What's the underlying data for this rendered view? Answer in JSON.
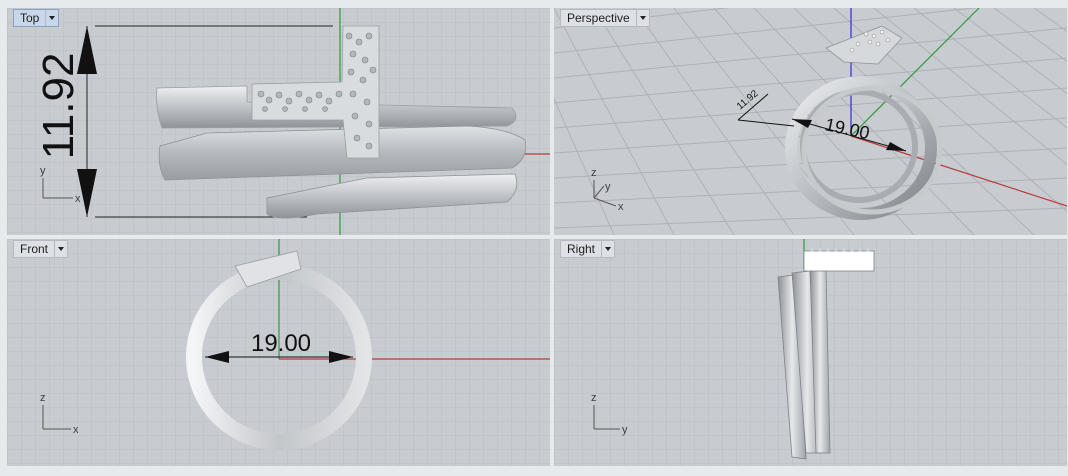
{
  "app": {
    "viewports": [
      {
        "id": "top",
        "title": "Top",
        "active": true
      },
      {
        "id": "perspective",
        "title": "Perspective",
        "active": false
      },
      {
        "id": "front",
        "title": "Front",
        "active": false
      },
      {
        "id": "right",
        "title": "Right",
        "active": false
      }
    ]
  },
  "dimensions": {
    "top_height": "11.92",
    "perspective_small": "11.92",
    "perspective_width": "19.00",
    "front_width": "19.00"
  },
  "axes": {
    "top": [
      "y",
      "x"
    ],
    "perspective": [
      "z",
      "y",
      "x"
    ],
    "front": [
      "z",
      "x"
    ],
    "right": [
      "z",
      "y"
    ]
  },
  "colors": {
    "viewport_bg": "#c8ccd1",
    "grid_minor": "#b9bec4",
    "grid_major": "#a9aeb5",
    "x_axis": "#b73b3b",
    "y_axis": "#2f9a3b",
    "z_axis": "#3030c8",
    "ring_metal": "#c9cbce"
  }
}
